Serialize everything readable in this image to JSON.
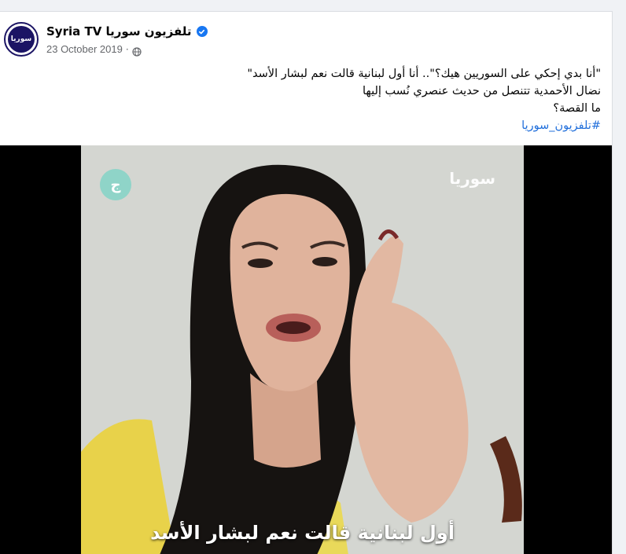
{
  "post": {
    "page_name": "Syria TV تلفزيون سوريا",
    "avatar_text": "سوريا",
    "date": "23 October 2019",
    "separator": "·",
    "icons": {
      "verified": "verified-badge-icon",
      "privacy": "globe-icon"
    },
    "lines": [
      "\"أنا بدي إحكي على السوريين هيك؟\".. أنا أول لبنانية قالت نعم لبشار الأسد\"",
      "نضال الأحمدية تتنصل من حديث عنصري نُسب إليها",
      "ما القصة؟"
    ],
    "hashtag": "#تلفزيون_سوريا"
  },
  "video": {
    "channel_logo": "سوريا",
    "corner_badge": "ج",
    "subtitle": "أول لبنانية قالت نعم لبشار الأسد"
  },
  "colors": {
    "accent": "#1877f2",
    "hashtag": "#216fdb",
    "brand": "#1b1464"
  }
}
